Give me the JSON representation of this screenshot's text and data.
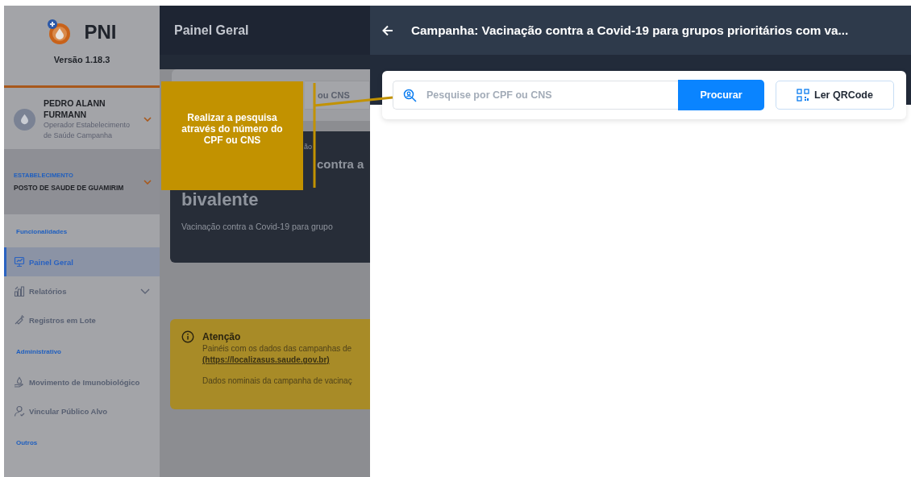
{
  "sidebar": {
    "logo_text": "PNI",
    "version": "Versão 1.18.3",
    "user": {
      "name": "PEDRO ALANN FURMANN",
      "role": "Operador Estabelecimento de Saúde Campanha"
    },
    "establishment": {
      "label": "ESTABELECIMENTO",
      "name": "POSTO DE SAUDE DE GUAMIRIM"
    },
    "sections": [
      {
        "title": "Funcionalidades",
        "items": [
          {
            "label": "Painel Geral",
            "kind": "link",
            "selected": true
          },
          {
            "label": "Relatórios",
            "kind": "group",
            "selected": false
          },
          {
            "label": "Registros em Lote",
            "kind": "link",
            "selected": false
          }
        ]
      },
      {
        "title": "Administrativo",
        "items": [
          {
            "label": "Movimento de Imunobiológico",
            "kind": "link",
            "selected": false
          },
          {
            "label": "Vincular Público Alvo",
            "kind": "link",
            "selected": false
          }
        ]
      },
      {
        "title": "Outros"
      }
    ]
  },
  "main": {
    "title": "Painel Geral",
    "search_fragment": "ou CNS",
    "campaign_card": {
      "label_fragment": "ão",
      "heading_fragment": "contra a",
      "heading_line_2": "bivalente",
      "subtitle": "Vacinação contra a Covid-19 para grupo"
    },
    "notice": {
      "title": "Atenção",
      "lines": [
        {
          "kind": "text",
          "text": "Painéis com os dados das campanhas de"
        },
        {
          "kind": "link",
          "text": "(https://localizasus.saude.gov.br)"
        },
        {
          "kind": "text",
          "text": "Dados nominais da campanha de vacinaç"
        }
      ]
    }
  },
  "annotation": {
    "text": "Realizar a pesquisa através do número do CPF ou CNS"
  },
  "panel": {
    "title": "Campanha: Vacinação contra a Covid-19 para grupos prioritários com va...",
    "search": {
      "placeholder": "Pesquise por CPF ou CNS"
    },
    "buttons": [
      {
        "label": "Procurar",
        "kind": "primary"
      },
      {
        "label": "Ler QRCode",
        "kind": "qrcode"
      }
    ]
  }
}
